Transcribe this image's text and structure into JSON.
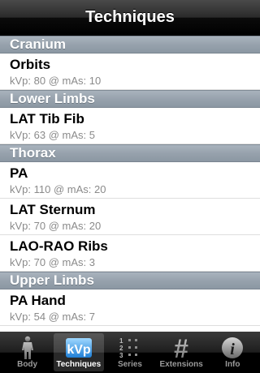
{
  "nav": {
    "title": "Techniques"
  },
  "sections": [
    {
      "header": "Cranium",
      "rows": [
        {
          "title": "Orbits",
          "subtitle": "kVp: 80 @ mAs: 10"
        }
      ]
    },
    {
      "header": "Lower Limbs",
      "rows": [
        {
          "title": "LAT Tib Fib",
          "subtitle": "kVp: 63 @ mAs: 5"
        }
      ]
    },
    {
      "header": "Thorax",
      "rows": [
        {
          "title": "PA",
          "subtitle": "kVp: 110 @ mAs: 20"
        },
        {
          "title": "LAT Sternum",
          "subtitle": "kVp: 70 @ mAs: 20"
        },
        {
          "title": "LAO-RAO Ribs",
          "subtitle": "kVp: 70 @ mAs: 3"
        }
      ]
    },
    {
      "header": "Upper Limbs",
      "rows": [
        {
          "title": "PA Hand",
          "subtitle": "kVp: 54 @ mAs: 7"
        }
      ]
    }
  ],
  "tabbar": {
    "tabs": [
      {
        "label": "Body",
        "icon": "body-figure-icon",
        "selected": false
      },
      {
        "label": "Techniques",
        "icon": "kvp-icon",
        "icon_text": "kVp",
        "selected": true
      },
      {
        "label": "Series",
        "icon": "numbered-list-icon",
        "icon_text": "1 2 3",
        "selected": false
      },
      {
        "label": "Extensions",
        "icon": "hash-icon",
        "icon_text": "#",
        "selected": false
      },
      {
        "label": "Info",
        "icon": "info-icon",
        "icon_text": "i",
        "selected": false
      }
    ]
  }
}
